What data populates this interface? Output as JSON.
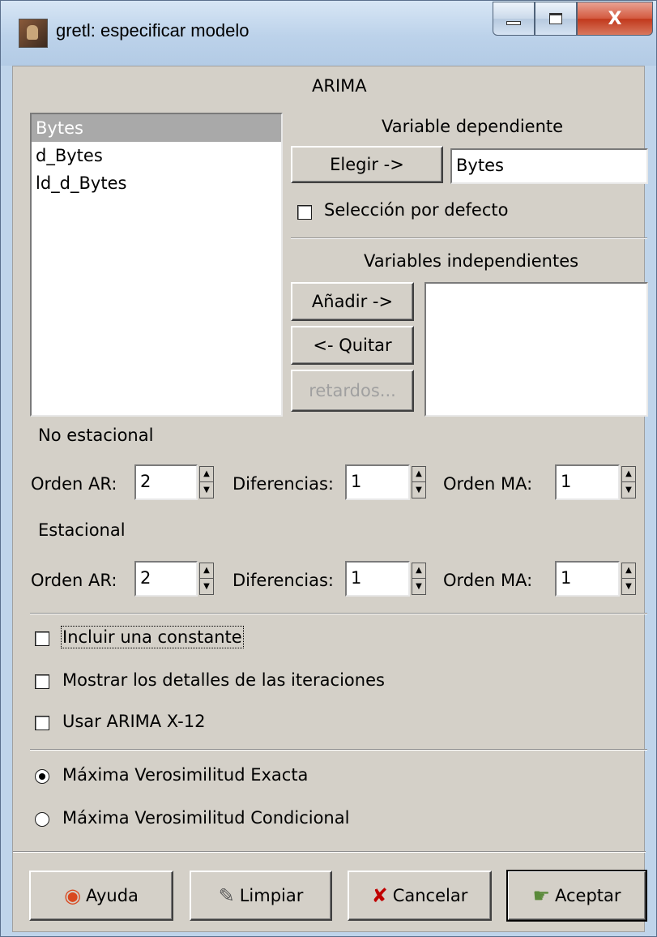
{
  "window": {
    "title": "gretl: especificar modelo",
    "caption_min": "—",
    "caption_max": "□",
    "caption_close": "X"
  },
  "dialog": {
    "heading": "ARIMA",
    "variable_list": [
      "Bytes",
      "d_Bytes",
      "ld_d_Bytes"
    ],
    "dependent": {
      "label": "Variable dependiente",
      "choose_button": "Elegir ->",
      "value": "Bytes",
      "default_checkbox": "Selección por defecto",
      "default_checked": false
    },
    "independent": {
      "label": "Variables independientes",
      "add_button": "Añadir ->",
      "remove_button": "<- Quitar",
      "lags_button": "retardos...",
      "values": []
    },
    "non_seasonal": {
      "heading": "No estacional",
      "ar_label": "Orden AR:",
      "ar_value": "2",
      "diff_label": "Diferencias:",
      "diff_value": "1",
      "ma_label": "Orden MA:",
      "ma_value": "1"
    },
    "seasonal": {
      "heading": "Estacional",
      "ar_label": "Orden AR:",
      "ar_value": "2",
      "diff_label": "Diferencias:",
      "diff_value": "1",
      "ma_label": "Orden MA:",
      "ma_value": "1"
    },
    "options": {
      "constant": "Incluir una constante",
      "constant_checked": false,
      "iterations": "Mostrar los detalles de las iteraciones",
      "iterations_checked": false,
      "x12": "Usar ARIMA X-12",
      "x12_checked": false
    },
    "estimation": {
      "exact": "Máxima Verosimilitud Exacta",
      "conditional": "Máxima Verosimilitud Condicional",
      "selected": "exact"
    },
    "buttons": {
      "help": "Ayuda",
      "clear": "Limpiar",
      "cancel": "Cancelar",
      "accept": "Aceptar"
    }
  }
}
